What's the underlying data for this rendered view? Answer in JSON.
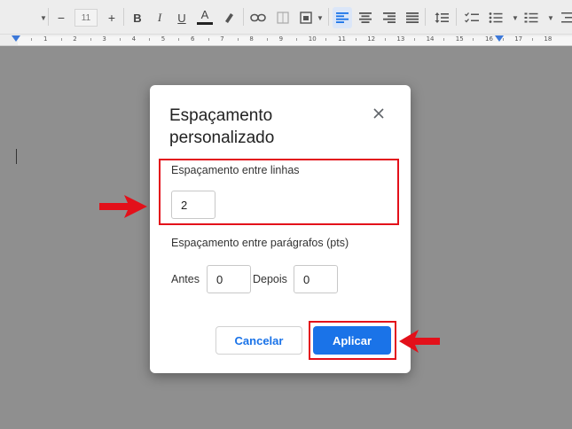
{
  "toolbar": {
    "font_size": "11",
    "minus": "−",
    "plus": "+",
    "bold": "B",
    "italic": "I",
    "underline": "U",
    "text_color": "A"
  },
  "ruler": {
    "numbers": [
      "1",
      "2",
      "3",
      "4",
      "5",
      "6",
      "7",
      "8",
      "9",
      "10",
      "11",
      "12",
      "13",
      "14",
      "15",
      "16",
      "17",
      "18"
    ]
  },
  "dialog": {
    "title": "Espaçamento personalizado",
    "line_spacing_label": "Espaçamento entre linhas",
    "line_spacing_value": "2",
    "paragraph_spacing_label": "Espaçamento entre parágrafos (pts)",
    "before_label": "Antes",
    "before_value": "0",
    "after_label": "Depois",
    "after_value": "0",
    "cancel_label": "Cancelar",
    "apply_label": "Aplicar"
  },
  "colors": {
    "accent": "#1a73e8",
    "annotation": "#e3101a"
  }
}
